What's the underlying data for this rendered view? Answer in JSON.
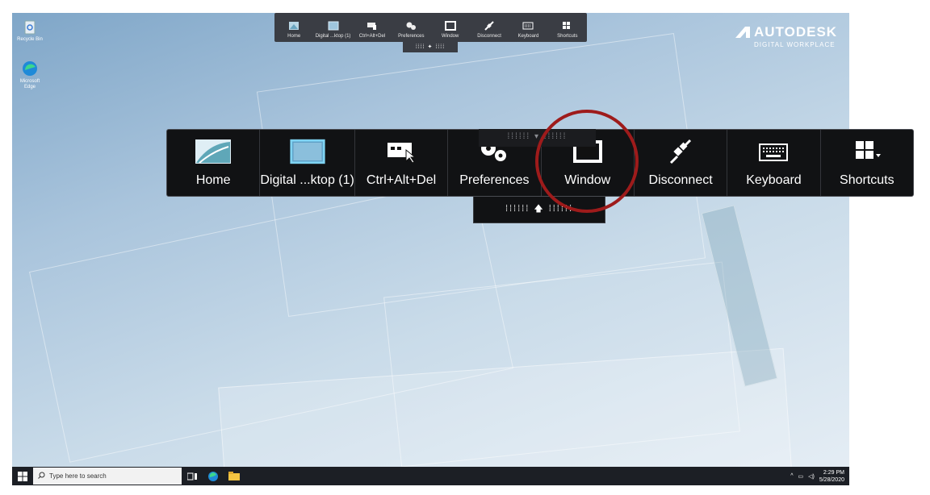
{
  "brand": {
    "name": "AUTODESK",
    "subtitle": "DIGITAL WORKPLACE"
  },
  "desktop_icons": [
    {
      "label": "Recycle Bin",
      "icon": "recycle-bin-icon"
    },
    {
      "label": "Microsoft Edge",
      "icon": "edge-icon"
    }
  ],
  "mini_toolbar": {
    "items": [
      {
        "label": "Home",
        "icon": "home-icon"
      },
      {
        "label": "Digital ...ktop (1)",
        "icon": "desktop-icon"
      },
      {
        "label": "Ctrl+Alt+Del",
        "icon": "ctrl-alt-del-icon"
      },
      {
        "label": "Preferences",
        "icon": "gears-icon"
      },
      {
        "label": "Window",
        "icon": "window-icon"
      },
      {
        "label": "Disconnect",
        "icon": "plug-icon"
      },
      {
        "label": "Keyboard",
        "icon": "keyboard-icon"
      },
      {
        "label": "Shortcuts",
        "icon": "shortcuts-icon"
      }
    ]
  },
  "toolbar": {
    "items": [
      {
        "label": "Home",
        "icon": "home-icon"
      },
      {
        "label": "Digital ...ktop (1)",
        "icon": "desktop-icon"
      },
      {
        "label": "Ctrl+Alt+Del",
        "icon": "ctrl-alt-del-icon"
      },
      {
        "label": "Preferences",
        "icon": "gears-icon"
      },
      {
        "label": "Window",
        "icon": "window-icon"
      },
      {
        "label": "Disconnect",
        "icon": "plug-icon"
      },
      {
        "label": "Keyboard",
        "icon": "keyboard-icon"
      },
      {
        "label": "Shortcuts",
        "icon": "shortcuts-icon"
      }
    ],
    "highlighted": "Window"
  },
  "taskbar": {
    "search_placeholder": "Type here to search",
    "time": "2:29 PM",
    "date": "5/28/2020"
  },
  "colors": {
    "highlight_circle": "#9e1b1b",
    "toolbar_bg": "#111214",
    "taskbar_bg": "#1c1f25"
  }
}
